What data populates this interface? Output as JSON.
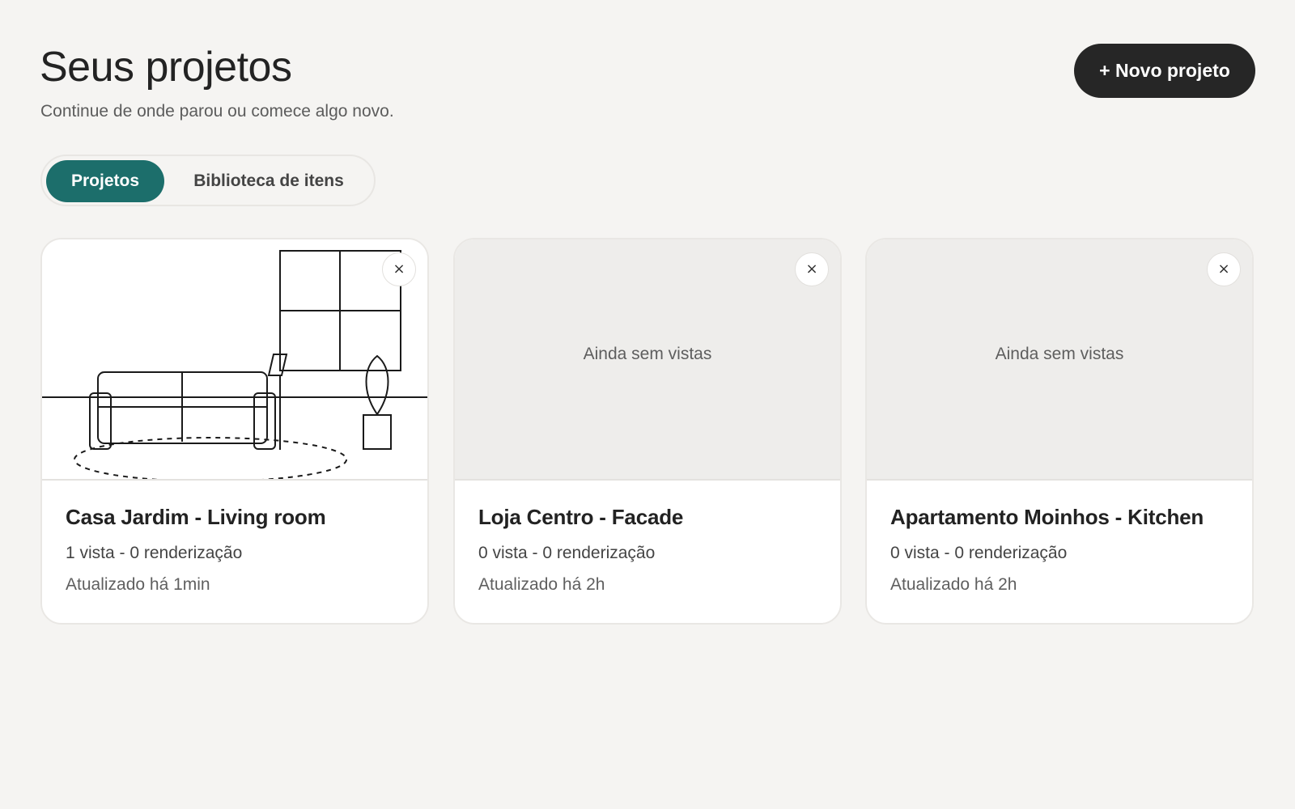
{
  "header": {
    "title": "Seus projetos",
    "subtitle": "Continue de onde parou ou comece algo novo.",
    "new_project_label": "+ Novo projeto"
  },
  "tabs": [
    {
      "label": "Projetos",
      "active": true
    },
    {
      "label": "Biblioteca de itens",
      "active": false
    }
  ],
  "projects": [
    {
      "title": "Casa Jardim - Living room",
      "meta": "1 vista - 0 renderização",
      "updated": "Atualizado há 1min",
      "has_preview": true,
      "empty_label": ""
    },
    {
      "title": "Loja Centro - Facade",
      "meta": "0 vista - 0 renderização",
      "updated": "Atualizado há 2h",
      "has_preview": false,
      "empty_label": "Ainda sem vistas"
    },
    {
      "title": "Apartamento Moinhos - Kitchen",
      "meta": "0 vista - 0 renderização",
      "updated": "Atualizado há 2h",
      "has_preview": false,
      "empty_label": "Ainda sem vistas"
    }
  ],
  "icons": {
    "close": "×"
  },
  "colors": {
    "accent": "#1c6e6b",
    "primary_button": "#262626",
    "background": "#f5f4f2"
  }
}
